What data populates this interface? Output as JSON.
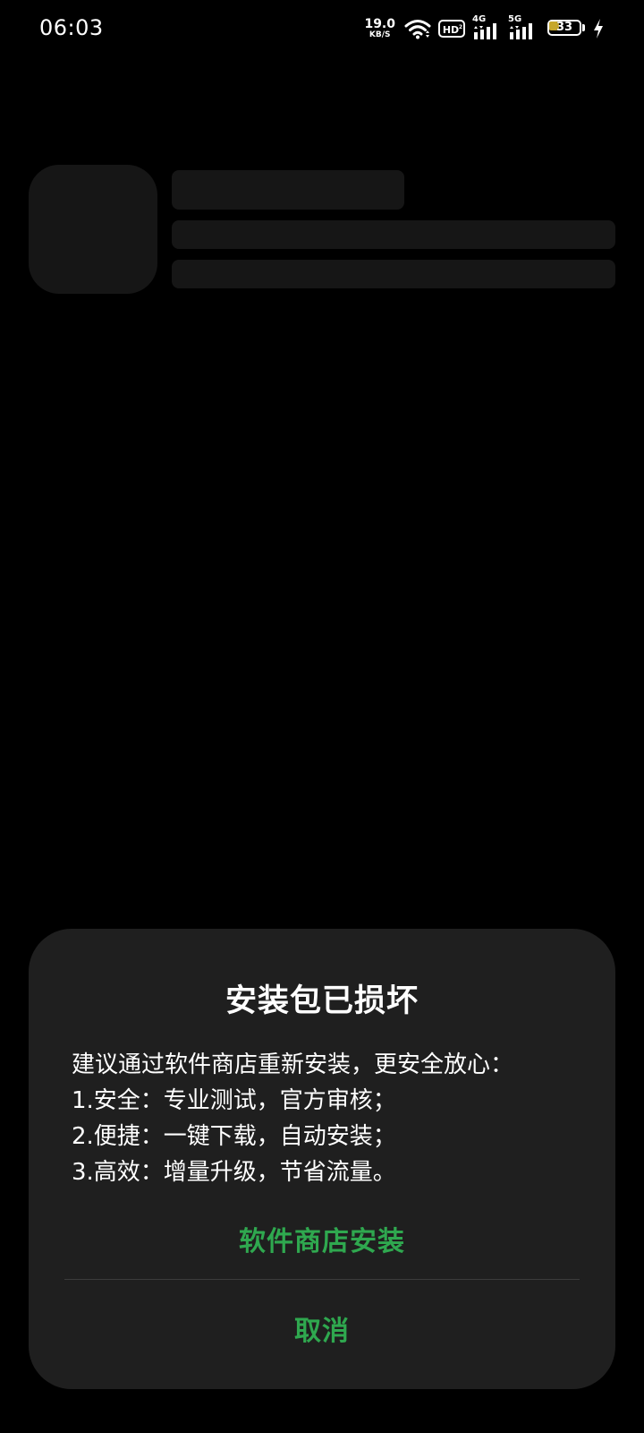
{
  "status_bar": {
    "time": "06:03",
    "net_speed_value": "19.0",
    "net_speed_unit": "KB/S",
    "hd_label": "HD",
    "signal_1_label": "4G",
    "signal_2_label": "5G",
    "battery_level": "33",
    "battery_percent": 33,
    "icons": [
      "wifi-icon",
      "hd-voice-icon",
      "signal-4g-icon",
      "signal-5g-icon",
      "battery-icon",
      "charging-bolt-icon"
    ]
  },
  "dialog": {
    "title": "安装包已损坏",
    "body": {
      "intro": "建议通过软件商店重新安装，更安全放心：",
      "point_1": "1.安全：专业测试，官方审核；",
      "point_2": "2.便捷：一键下载，自动安装；",
      "point_3": "3.高效：增量升级，节省流量。"
    },
    "primary_action": "软件商店安装",
    "cancel_action": "取消"
  },
  "colors": {
    "background": "#000000",
    "dialog_background": "#1f1f1f",
    "skeleton": "#161616",
    "accent_green": "#2fa84f",
    "battery_fill": "#c6a72c"
  }
}
